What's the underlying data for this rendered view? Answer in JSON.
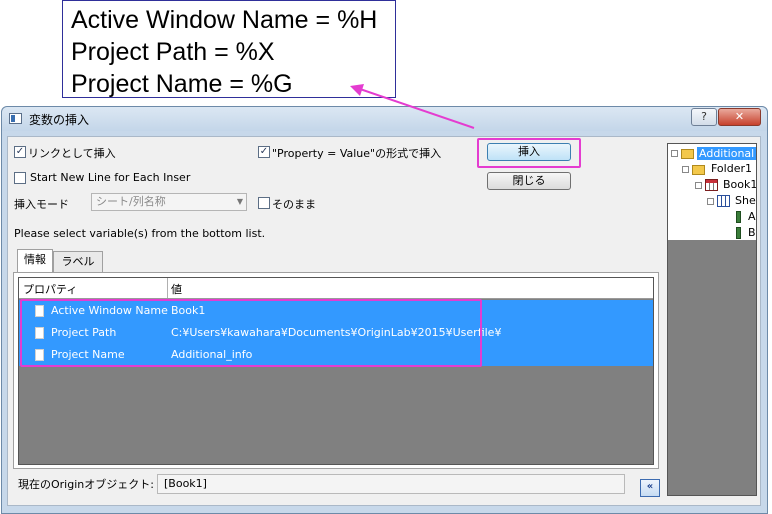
{
  "callout": {
    "lines": [
      "Active Window Name = %H",
      "Project Path = %X",
      "Project Name = %G"
    ]
  },
  "window": {
    "title": "変数の挿入",
    "help_label": "?",
    "close_label": "✕"
  },
  "options": {
    "link_insert_label": "リンクとして挿入",
    "link_insert_checked": true,
    "property_value_label": "\"Property = Value\"の形式で挿入",
    "property_value_checked": true,
    "new_line_label": "Start New Line for Each Inser",
    "new_line_checked": false,
    "mode_label": "挿入モード",
    "mode_value": "シート/列名称",
    "asis_label": "そのまま",
    "asis_checked": false,
    "hint": "Please select variable(s) from the bottom list."
  },
  "buttons": {
    "insert": "挿入",
    "close": "閉じる",
    "collapse": "«"
  },
  "tabs": [
    {
      "label": "情報",
      "active": true
    },
    {
      "label": "ラベル",
      "active": false
    }
  ],
  "grid": {
    "headers": [
      "プロパティ",
      "値"
    ],
    "rows": [
      {
        "name": "Active Window Name",
        "value": "Book1"
      },
      {
        "name": "Project Path",
        "value": "C:¥Users¥kawahara¥Documents¥OriginLab¥2015¥Userfile¥"
      },
      {
        "name": "Project Name",
        "value": "Additional_info"
      }
    ]
  },
  "status": {
    "label": "現在のOriginオブジェクト:",
    "value": "[Book1]"
  },
  "tree": {
    "root": "Additional",
    "folder": "Folder1",
    "book": "Book1",
    "sheet": "She",
    "col_a": "A",
    "col_b": "B"
  },
  "colors": {
    "highlight": "#e43cd0",
    "selection": "#3399ff"
  }
}
